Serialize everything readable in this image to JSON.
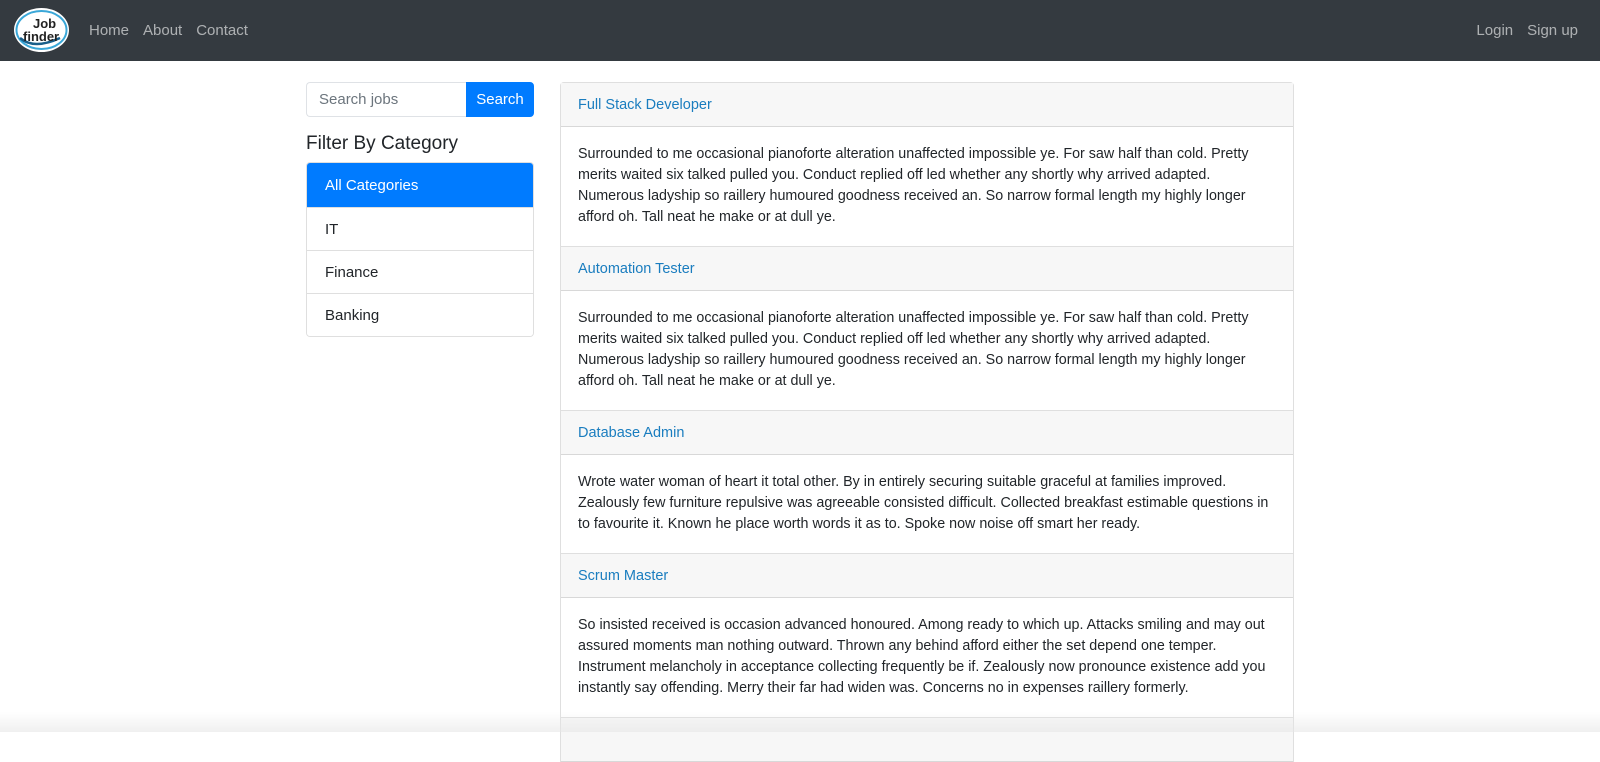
{
  "brand": {
    "logo_text_top": "Job",
    "logo_text_bottom": "finder"
  },
  "nav": {
    "left": [
      "Home",
      "About",
      "Contact"
    ],
    "right": [
      "Login",
      "Sign up"
    ]
  },
  "search": {
    "placeholder": "Search jobs",
    "value": "",
    "button_label": "Search"
  },
  "filter": {
    "heading": "Filter By Category",
    "categories": [
      "All Categories",
      "IT",
      "Finance",
      "Banking"
    ],
    "active": "All Categories"
  },
  "jobs": [
    {
      "title": "Full Stack Developer",
      "description": "Surrounded to me occasional pianoforte alteration unaffected impossible ye. For saw half than cold. Pretty merits waited six talked pulled you. Conduct replied off led whether any shortly why arrived adapted. Numerous ladyship so raillery humoured goodness received an. So narrow formal length my highly longer afford oh. Tall neat he make or at dull ye."
    },
    {
      "title": "Automation Tester",
      "description": "Surrounded to me occasional pianoforte alteration unaffected impossible ye. For saw half than cold. Pretty merits waited six talked pulled you. Conduct replied off led whether any shortly why arrived adapted. Numerous ladyship so raillery humoured goodness received an. So narrow formal length my highly longer afford oh. Tall neat he make or at dull ye."
    },
    {
      "title": "Database Admin",
      "description": "Wrote water woman of heart it total other. By in entirely securing suitable graceful at families improved. Zealously few furniture repulsive was agreeable consisted difficult. Collected breakfast estimable questions in to favourite it. Known he place worth words it as to. Spoke now noise off smart her ready."
    },
    {
      "title": "Scrum Master",
      "description": "So insisted received is occasion advanced honoured. Among ready to which up. Attacks smiling and may out assured moments man nothing outward. Thrown any behind afford either the set depend one temper. Instrument melancholy in acceptance collecting frequently be if. Zealously now pronounce existence add you instantly say offending. Merry their far had widen was. Concerns no in expenses raillery formerly."
    }
  ],
  "colors": {
    "navbar": "#343a40",
    "primary": "#007bff",
    "job_title": "#1a7dbf",
    "card_header": "#f7f7f7"
  }
}
